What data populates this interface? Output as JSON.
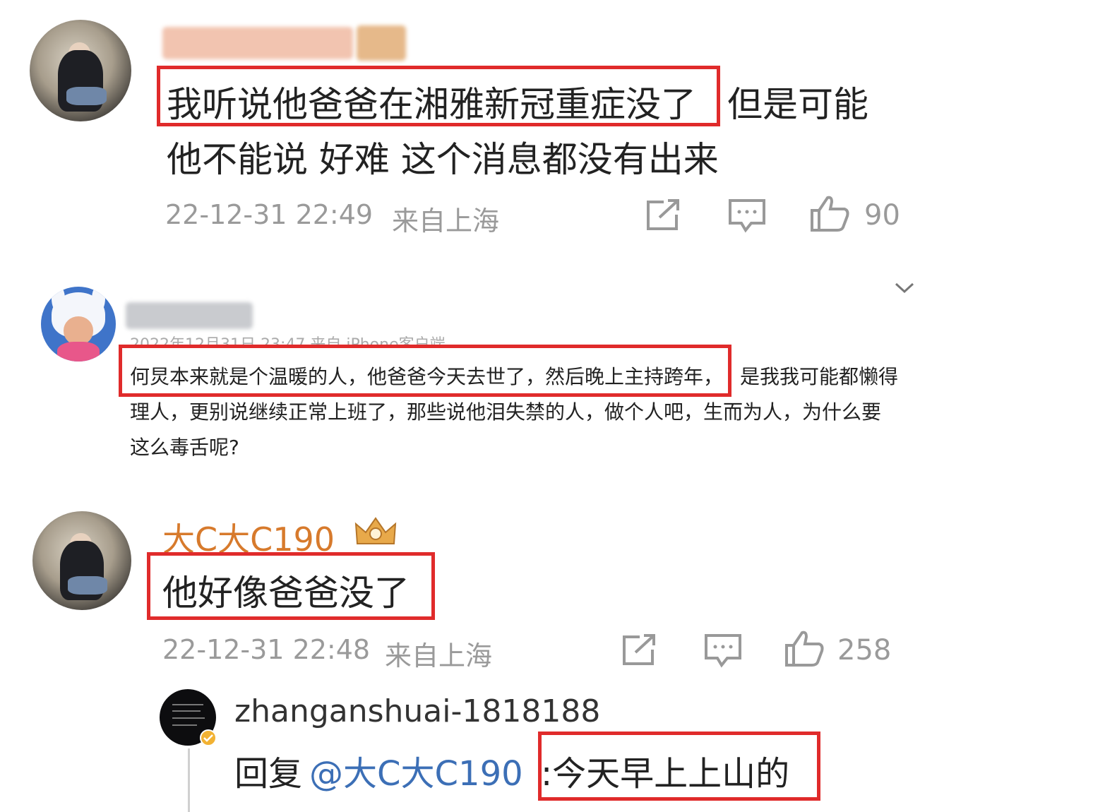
{
  "comments": [
    {
      "text_line1_highlight": "我听说他爸爸在湘雅新冠重症没了",
      "text_line1_rest": "但是可能",
      "text_line2": "他不能说 好难 这个消息都没有出来",
      "date": "22-12-31 22:49",
      "location": "来自上海",
      "likes": "90"
    },
    {
      "meta": "2022年12月31日 23:47 来自 iPhone客户端",
      "text_line1_highlight": "何炅本来就是个温暖的人，他爸爸今天去世了，然后晚上主持跨年，",
      "text_line1_rest": "是我我可能都懒得",
      "text_line2": "理人，更别说继续正常上班了，那些说他泪失禁的人，做个人吧，生而为人，为什么要",
      "text_line3": "这么毒舌呢?"
    },
    {
      "username": "大C大C190",
      "text": "他好像爸爸没了",
      "date": "22-12-31 22:48",
      "location": "来自上海",
      "likes": "258"
    }
  ],
  "reply": {
    "username": "zhanganshuai-1818188",
    "prefix": "回复",
    "mention": "@大C大C190",
    "text": ":今天早上上山的"
  },
  "colors": {
    "highlight_box": "#e02b2b",
    "username_orange": "#d77a2c",
    "mention_blue": "#3c6fb6",
    "meta_gray": "#9a9a9a"
  },
  "icons": [
    "share-icon",
    "comment-icon",
    "thumbs-up-icon",
    "chevron-down-icon",
    "crown-badge-icon",
    "verified-badge-icon"
  ]
}
